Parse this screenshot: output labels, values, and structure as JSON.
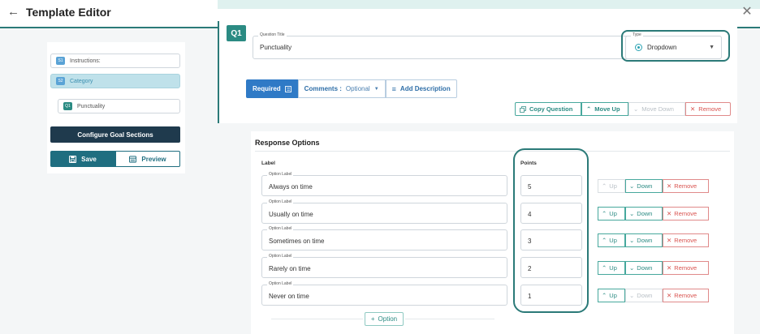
{
  "header": {
    "title": "Template Editor"
  },
  "sidebar": {
    "items": [
      {
        "badge": "S1",
        "label": "Instructions:"
      },
      {
        "badge": "S2",
        "label": "Category"
      },
      {
        "badge": "Q1",
        "label": "Punctuality"
      }
    ],
    "configure_label": "Configure Goal Sections",
    "save_label": "Save",
    "preview_label": "Preview"
  },
  "question": {
    "badge": "Q1",
    "title_label": "Question Title",
    "title_value": "Punctuality",
    "type_label": "Type",
    "type_value": "Dropdown",
    "tabs": {
      "required": "Required",
      "comments": "Comments :",
      "comments_value": "Optional",
      "add_description": "Add Description"
    },
    "actions": {
      "copy": "Copy Question",
      "move_up": "Move Up",
      "move_down": "Move Down",
      "remove": "Remove"
    }
  },
  "responses": {
    "title": "Response Options",
    "col_label": "Label",
    "col_points": "Points",
    "option_field_label": "Option Label",
    "up_label": "Up",
    "down_label": "Down",
    "remove_label": "Remove",
    "add_option": "Option",
    "options": [
      {
        "label": "Always on time",
        "points": "5"
      },
      {
        "label": "Usually on time",
        "points": "4"
      },
      {
        "label": "Sometimes on time",
        "points": "3"
      },
      {
        "label": "Rarely on time",
        "points": "2"
      },
      {
        "label": "Never on time",
        "points": "1"
      }
    ]
  },
  "colors": {
    "accent": "#2b7a78",
    "primary": "#2f7ac6",
    "danger": "#d9534f",
    "navy": "#1f3a4d"
  }
}
